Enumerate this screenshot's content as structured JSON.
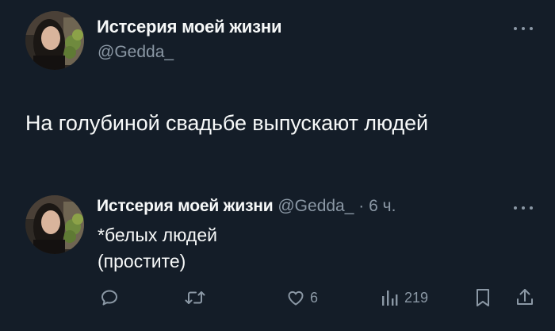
{
  "tweet": {
    "author_name": "Истсерия моей жизни",
    "author_handle": "@Gedda_",
    "text": "На голубиной свадьбе выпускают людей"
  },
  "reply": {
    "author_name": "Истсерия моей жизни",
    "author_handle": "@Gedda_",
    "separator": "·",
    "time": "6 ч.",
    "text_line1": "*белых людей",
    "text_line2": "(простите)"
  },
  "actions": {
    "likes": "6",
    "views": "219"
  },
  "icons": {
    "more": "more-horizontal-icon",
    "reply": "reply-bubble-icon",
    "retweet": "retweet-icon",
    "like": "heart-icon",
    "views": "analytics-bars-icon",
    "bookmark": "bookmark-icon",
    "share": "share-upload-icon"
  },
  "colors": {
    "background": "#141d28",
    "text_primary": "#f7f9f9",
    "text_secondary": "#8b98a5"
  }
}
